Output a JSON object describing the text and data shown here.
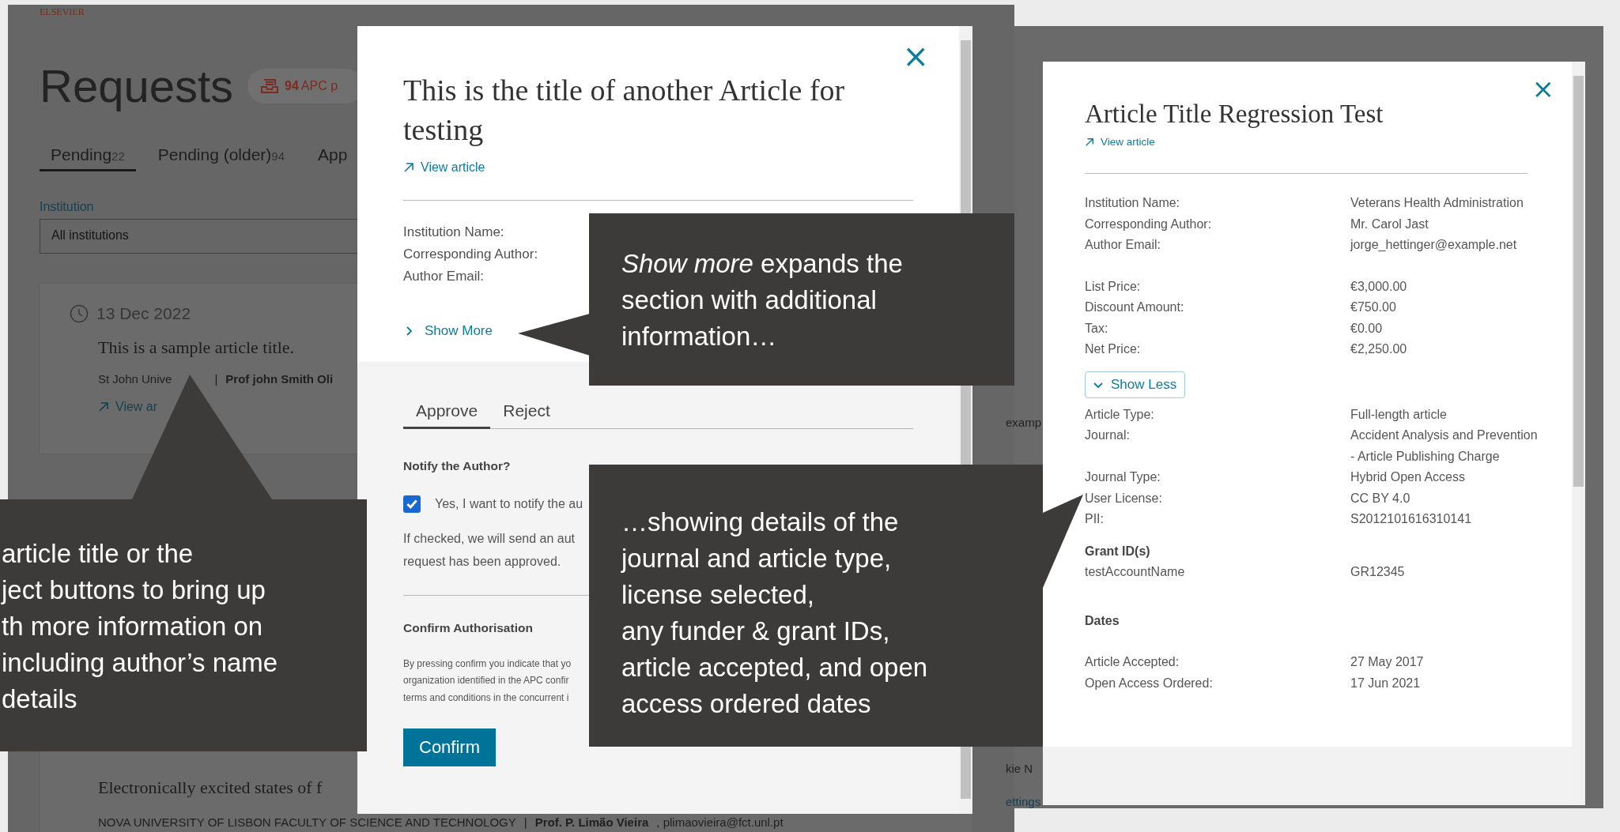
{
  "background_page": {
    "logo": "ELSEVIER",
    "heading": "Requests",
    "badge": {
      "count": "94",
      "text": "APC p"
    },
    "tabs": [
      {
        "label": "Pending",
        "count": "22",
        "selected": true
      },
      {
        "label": "Pending (older)",
        "count": "94",
        "selected": false
      },
      {
        "label": "App",
        "selected": false
      }
    ],
    "filter": {
      "label": "Institution",
      "value": "All institutions"
    },
    "cards": [
      {
        "date": "13 Dec 2022",
        "title": "This is a sample article title.",
        "institution": "St John Unive",
        "separator": "|",
        "author": "Prof john Smith Oli",
        "link": "View ar"
      },
      {
        "title": "Electronically excited states of f",
        "institution": "NOVA UNIVERSITY OF LISBON FACULTY OF SCIENCE AND TECHNOLOGY",
        "separator": "|",
        "author": "Prof. P. Limão Vieira",
        "email": ", plimaovieira@fct.unl.pt"
      }
    ],
    "fragments": [
      "examp",
      "kie N",
      "ettings"
    ]
  },
  "request_modal": {
    "close": "×",
    "title": "This is the title of another Article for testing",
    "link": "View article",
    "fields": [
      "Institution Name:",
      "Corresponding Author:",
      "Author Email:"
    ],
    "toggle": {
      "label": "Show More",
      "expanded": false
    },
    "tabs": [
      {
        "label": "Approve",
        "selected": true
      },
      {
        "label": "Reject",
        "selected": false
      }
    ],
    "notify_heading": "Notify the Author?",
    "notify": {
      "label": "Yes, I want to notify the au",
      "checked": true
    },
    "notify_note": [
      "If checked, we will send an aut",
      "request has been approved."
    ],
    "confirm_heading": "Confirm Authorisation",
    "confirm_note": [
      "By pressing confirm you indicate that yo",
      "organization identified in the APC confir",
      "terms and conditions in the concurrent i"
    ],
    "confirm_button": "Confirm"
  },
  "detail_modal": {
    "close": "×",
    "title": "Article Title Regression Test",
    "link": "View article",
    "contact": [
      {
        "label": "Institution Name:",
        "value": "Veterans Health Administration"
      },
      {
        "label": "Corresponding Author:",
        "value": "Mr. Carol Jast"
      },
      {
        "label": "Author Email:",
        "value": "jorge_hettinger@example.net"
      }
    ],
    "prices": [
      {
        "label": "List Price:",
        "value": "€3,000.00"
      },
      {
        "label": "Discount Amount:",
        "value": "€750.00"
      },
      {
        "label": "Tax:",
        "value": "€0.00"
      },
      {
        "label": "Net Price:",
        "value": "€2,250.00"
      }
    ],
    "toggle": {
      "label": "Show Less",
      "expanded": true
    },
    "details": [
      {
        "label": "Article Type:",
        "value": "Full-length article"
      },
      {
        "label": "Journal:",
        "value": "Accident Analysis and Prevention",
        "value_cont": "- Article Publishing Charge"
      },
      {
        "label": "Journal Type:",
        "value": "Hybrid Open Access"
      },
      {
        "label": "User License:",
        "value": "CC BY 4.0"
      },
      {
        "label": "PII:",
        "value": "S2012101616310141"
      }
    ],
    "grants": {
      "heading": "Grant ID(s)",
      "rows": [
        {
          "label": "testAccountName",
          "value": "GR12345"
        }
      ]
    },
    "dates": {
      "heading": "Dates",
      "rows": [
        {
          "label": "Article Accepted:",
          "value": "27 May 2017"
        },
        {
          "label": "Open Access Ordered:",
          "value": "17 Jun 2021"
        }
      ]
    }
  },
  "callouts": [
    {
      "lines": [
        "article title or the",
        "ject buttons to bring up",
        "th more information on",
        " including author’s name",
        "details"
      ]
    },
    {
      "lines": [
        "*Show more* expands the",
        "section with additional",
        "information…"
      ]
    },
    {
      "lines": [
        "…showing details of the",
        "journal and article type,",
        "license selected,",
        "any funder & grant IDs,",
        "article accepted, and open",
        "access ordered dates"
      ]
    }
  ]
}
